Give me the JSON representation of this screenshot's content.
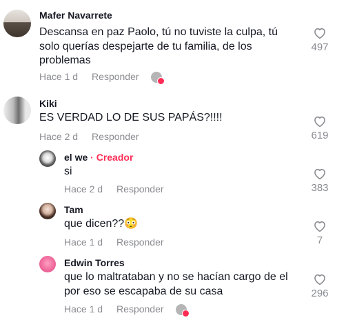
{
  "comments": [
    {
      "author": "Mafer Navarrete",
      "text": "Descansa en paz Paolo, tú no tuviste la culpa, tú solo querías despejarte de tu familia, de los problemas",
      "time": "Hace 1 d",
      "reply": "Responder",
      "likes": "497"
    },
    {
      "author": "Kiki",
      "text": "ES VERDAD LO DE SUS PAPÁS?!!!!",
      "time": "Hace 2 d",
      "reply": "Responder",
      "likes": "619"
    }
  ],
  "replies": [
    {
      "author": "el we",
      "badge": "Creador",
      "badge_separator": "·",
      "text": "si",
      "time": "Hace 2 d",
      "reply": "Responder",
      "likes": "383"
    },
    {
      "author": "Tam",
      "text": "que dicen??😳",
      "time": "Hace 1 d",
      "reply": "Responder",
      "likes": "7"
    },
    {
      "author": "Edwin Torres",
      "text": "que lo maltrataban y no se hacían cargo de el por eso se escapaba de su casa",
      "time": "Hace 1 d",
      "reply": "Responder",
      "likes": "296"
    }
  ],
  "colors": {
    "accent": "#fe2c55",
    "muted": "#8a8b91",
    "text": "#161823"
  },
  "icons": {
    "like": "heart-outline-icon",
    "creator_liked": "creator-liked-icon"
  }
}
